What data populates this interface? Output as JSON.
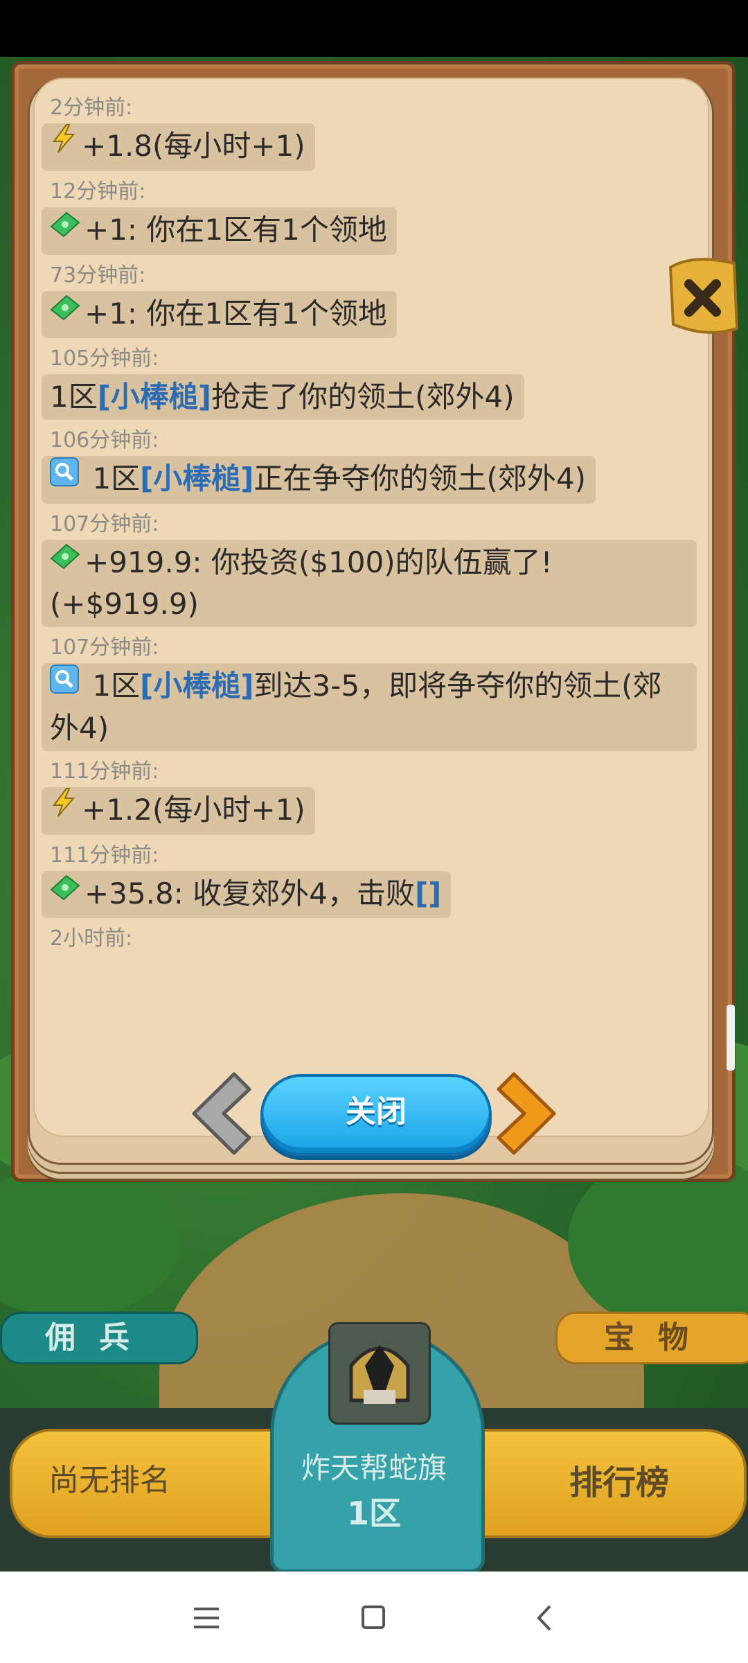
{
  "modal": {
    "entries": [
      {
        "time": "2分钟前:",
        "icon": "bolt-icon",
        "pre": "+1.8(每小时+1)",
        "name": "",
        "post": ""
      },
      {
        "time": "12分钟前:",
        "icon": "cash-icon",
        "pre": "+1: 你在1区有1个领地",
        "name": "",
        "post": ""
      },
      {
        "time": "73分钟前:",
        "icon": "cash-icon",
        "pre": "+1: 你在1区有1个领地",
        "name": "",
        "post": ""
      },
      {
        "time": "105分钟前:",
        "icon": "",
        "pre": "1区",
        "name": "[小棒槌]",
        "post": "抢走了你的领土(郊外4)"
      },
      {
        "time": "106分钟前:",
        "icon": "search-icon",
        "pre": " 1区",
        "name": "[小棒槌]",
        "post": "正在争夺你的领土(郊外4)"
      },
      {
        "time": "107分钟前:",
        "icon": "cash-icon",
        "pre": "+919.9: 你投资($100)的队伍赢了! (+$919.9)",
        "name": "",
        "post": ""
      },
      {
        "time": "107分钟前:",
        "icon": "search-icon",
        "pre": " 1区",
        "name": "[小棒槌]",
        "post": "到达3-5，即将争夺你的领土(郊外4)"
      },
      {
        "time": "111分钟前:",
        "icon": "bolt-icon",
        "pre": "+1.2(每小时+1)",
        "name": "",
        "post": ""
      },
      {
        "time": "111分钟前:",
        "icon": "cash-icon",
        "pre": "+35.8: 收复郊外4，击败",
        "name": "[]",
        "post": ""
      },
      {
        "time": "2小时前:",
        "icon": "",
        "pre": "",
        "name": "",
        "post": ""
      }
    ],
    "close_label": "关闭"
  },
  "side": {
    "mercenary_label": "佣兵",
    "treasure_label": "宝物"
  },
  "bottom": {
    "rank_label": "尚无排名",
    "clan_name": "炸天帮蛇旗",
    "zone": "1区",
    "leaderboard_label": "排行榜"
  },
  "colors": {
    "name_link": "#2c6cb3",
    "close_button": "#18a3e6",
    "page": "#eed8b6"
  }
}
